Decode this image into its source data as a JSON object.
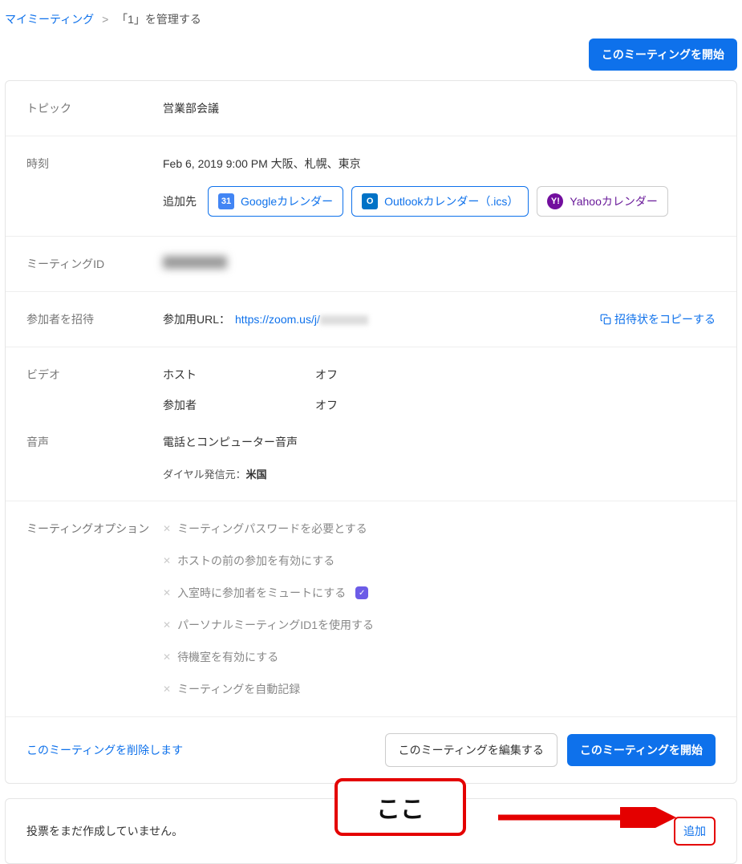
{
  "breadcrumb": {
    "parent": "マイミーティング",
    "current": "「1」を管理する"
  },
  "buttons": {
    "start_meeting": "このミーティングを開始",
    "edit_meeting": "このミーティングを編集する",
    "delete_meeting": "このミーティングを削除します",
    "add_poll": "追加"
  },
  "labels": {
    "topic": "トピック",
    "time": "時刻",
    "add_to": "追加先",
    "meeting_id": "ミーティングID",
    "invite": "参加者を招待",
    "join_url_label": "参加用URL：",
    "copy_invite": "招待状をコピーする",
    "video": "ビデオ",
    "host": "ホスト",
    "participant": "参加者",
    "off": "オフ",
    "audio": "音声",
    "options": "ミーティングオプション"
  },
  "topic_value": "営業部会議",
  "time_value": "Feb 6, 2019 9:00 PM 大阪、札幌、東京",
  "calendars": {
    "google": "Googleカレンダー",
    "outlook": "Outlookカレンダー（.ics）",
    "yahoo": "Yahooカレンダー"
  },
  "join_url_prefix": "https://zoom.us/j/",
  "audio_value": "電話とコンピューター音声",
  "audio_dial": "ダイヤル発信元：",
  "audio_dial_country": "米国",
  "options_list": [
    "ミーティングパスワードを必要とする",
    "ホストの前の参加を有効にする",
    "入室時に参加者をミュートにする",
    "パーソナルミーティングID1を使用する",
    "待機室を有効にする",
    "ミーティングを自動記録"
  ],
  "option_badge_index": 2,
  "poll_empty": "投票をまだ作成していません。",
  "annotation": "ここ"
}
